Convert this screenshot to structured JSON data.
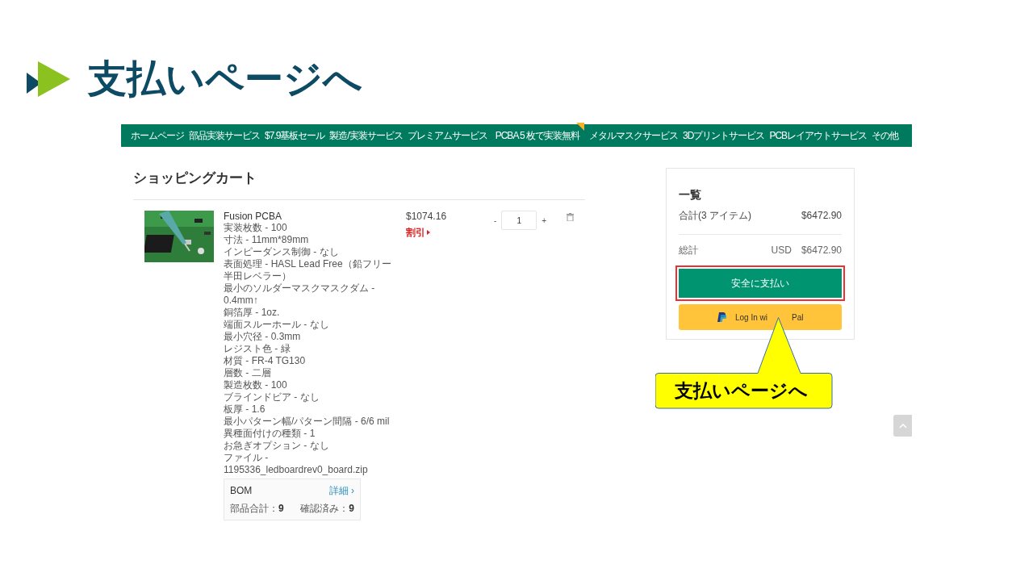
{
  "slide_title": "支払いページへ",
  "nav": [
    {
      "label": "ホームページ",
      "kind": "plain"
    },
    {
      "label": "部品実装サービス",
      "kind": "plain"
    },
    {
      "label": "$7.9基板セール",
      "kind": "plain"
    },
    {
      "label": "製造/実装サービス",
      "kind": "plain"
    },
    {
      "label": "プレミアムサービス",
      "kind": "plain"
    },
    {
      "label": "PCBA 5 枚で実装無料",
      "kind": "promo"
    },
    {
      "label": "メタルマスクサービス",
      "kind": "plain"
    },
    {
      "label": "3Dプリントサービス",
      "kind": "plain"
    },
    {
      "label": "PCBレイアウトサービス",
      "kind": "plain"
    },
    {
      "label": "その他",
      "kind": "plain"
    }
  ],
  "cart": {
    "title": "ショッピングカート",
    "item": {
      "name": "Fusion PCBA",
      "price": "$1074.16",
      "discount": "割引",
      "quantity_minus": "-",
      "quantity": "1",
      "quantity_plus": "+",
      "details": [
        "実装枚数 - 100",
        "寸法 - 11mm*89mm",
        "インピーダンス制御 - なし",
        "表面処理 - HASL Lead Free（鉛フリー半田レベラー）",
        "最小のソルダーマスクマスクダム - 0.4mm↑",
        "銅箔厚 - 1oz.",
        "端面スルーホール - なし",
        "最小穴径 - 0.3mm",
        "レジスト色 - 緑",
        "材質 - FR-4 TG130",
        "層数 - 二層",
        "製造枚数 - 100",
        "ブラインドビア - なし",
        "板厚 - 1.6",
        "最小パターン幅/パターン間隔 - 6/6 mil",
        "異種面付けの種類 - 1",
        "お急ぎオプション - なし",
        "ファイル - 1195336_ledboardrev0_board.zip"
      ],
      "bom": {
        "title": "BOM",
        "link": "詳細 ›",
        "total_label": "部品合計：",
        "total": "9",
        "confirmed_label": "確認済み：",
        "confirmed": "9"
      }
    }
  },
  "summary": {
    "title": "一覧",
    "subtotal_label": "合計(3 アイテム)",
    "subtotal": "$6472.90",
    "total_label": "総計",
    "currency": "USD",
    "total": "$6472.90",
    "pay_button": "安全に支払い",
    "paypal_button_parts": [
      "Log In wi",
      "Pal"
    ]
  },
  "callout": "支払いページへ"
}
